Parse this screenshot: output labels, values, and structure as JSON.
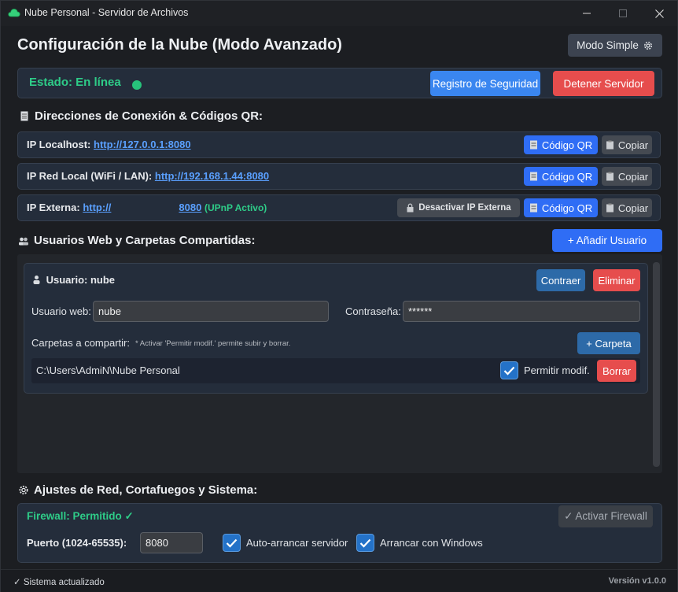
{
  "window": {
    "title": "Nube Personal - Servidor de Archivos"
  },
  "header": {
    "title": "Configuración de la Nube (Modo Avanzado)",
    "mode_button": "Modo Simple"
  },
  "status": {
    "text": "Estado: En línea",
    "security_log_button": "Registro de Seguridad",
    "stop_button": "Detener Servidor",
    "dot_color": "#27c37b"
  },
  "connections": {
    "section_title": "Direcciones de Conexión & Códigos QR:",
    "rows": [
      {
        "label": "IP Localhost:",
        "url": "http://127.0.0.1:8080",
        "qr_label": "Código QR",
        "copy_label": "Copiar"
      },
      {
        "label": "IP Red Local (WiFi / LAN):",
        "url": "http://192.168.1.44:8080",
        "qr_label": "Código QR",
        "copy_label": "Copiar"
      },
      {
        "label": "IP Externa:",
        "url_start": "http://",
        "url_port": "8080",
        "status": "(UPnP Activo)",
        "disable_label": "Desactivar IP Externa",
        "qr_label": "Código QR",
        "copy_label": "Copiar"
      }
    ]
  },
  "users": {
    "section_title": "Usuarios Web y Carpetas Compartidas:",
    "add_button": "+ Añadir Usuario",
    "card": {
      "heading": "Usuario: nube",
      "collapse_button": "Contraer",
      "delete_button": "Eliminar",
      "web_user_label": "Usuario web:",
      "web_user_value": "nube",
      "password_label": "Contraseña:",
      "password_value": "******",
      "folders_label": "Carpetas a compartir:",
      "folders_note": "* Activar 'Permitir modif.' permite subir y borrar.",
      "add_folder_button": "+ Carpeta",
      "folder": {
        "path": "C:\\Users\\AdmiN\\Nube Personal",
        "allow_modify_label": "Permitir modif.",
        "allow_modify_checked": true,
        "remove_button": "Borrar"
      }
    }
  },
  "network": {
    "section_title": "Ajustes de Red, Cortafuegos y Sistema:",
    "firewall_status": "Firewall: Permitido ✓",
    "activate_firewall_button": "✓ Activar Firewall",
    "port_label": "Puerto (1024-65535):",
    "port_value": "8080",
    "auto_start_label": "Auto-arrancar servidor",
    "auto_start_checked": true,
    "windows_start_label": "Arrancar con Windows",
    "windows_start_checked": true
  },
  "footer": {
    "status": "✓ Sistema actualizado",
    "version": "Versión v1.0.0"
  },
  "colors": {
    "accent_blue": "#2f6df5",
    "danger_red": "#e64d4d",
    "success_green": "#2ecc88",
    "link_blue": "#5aa0ff"
  }
}
